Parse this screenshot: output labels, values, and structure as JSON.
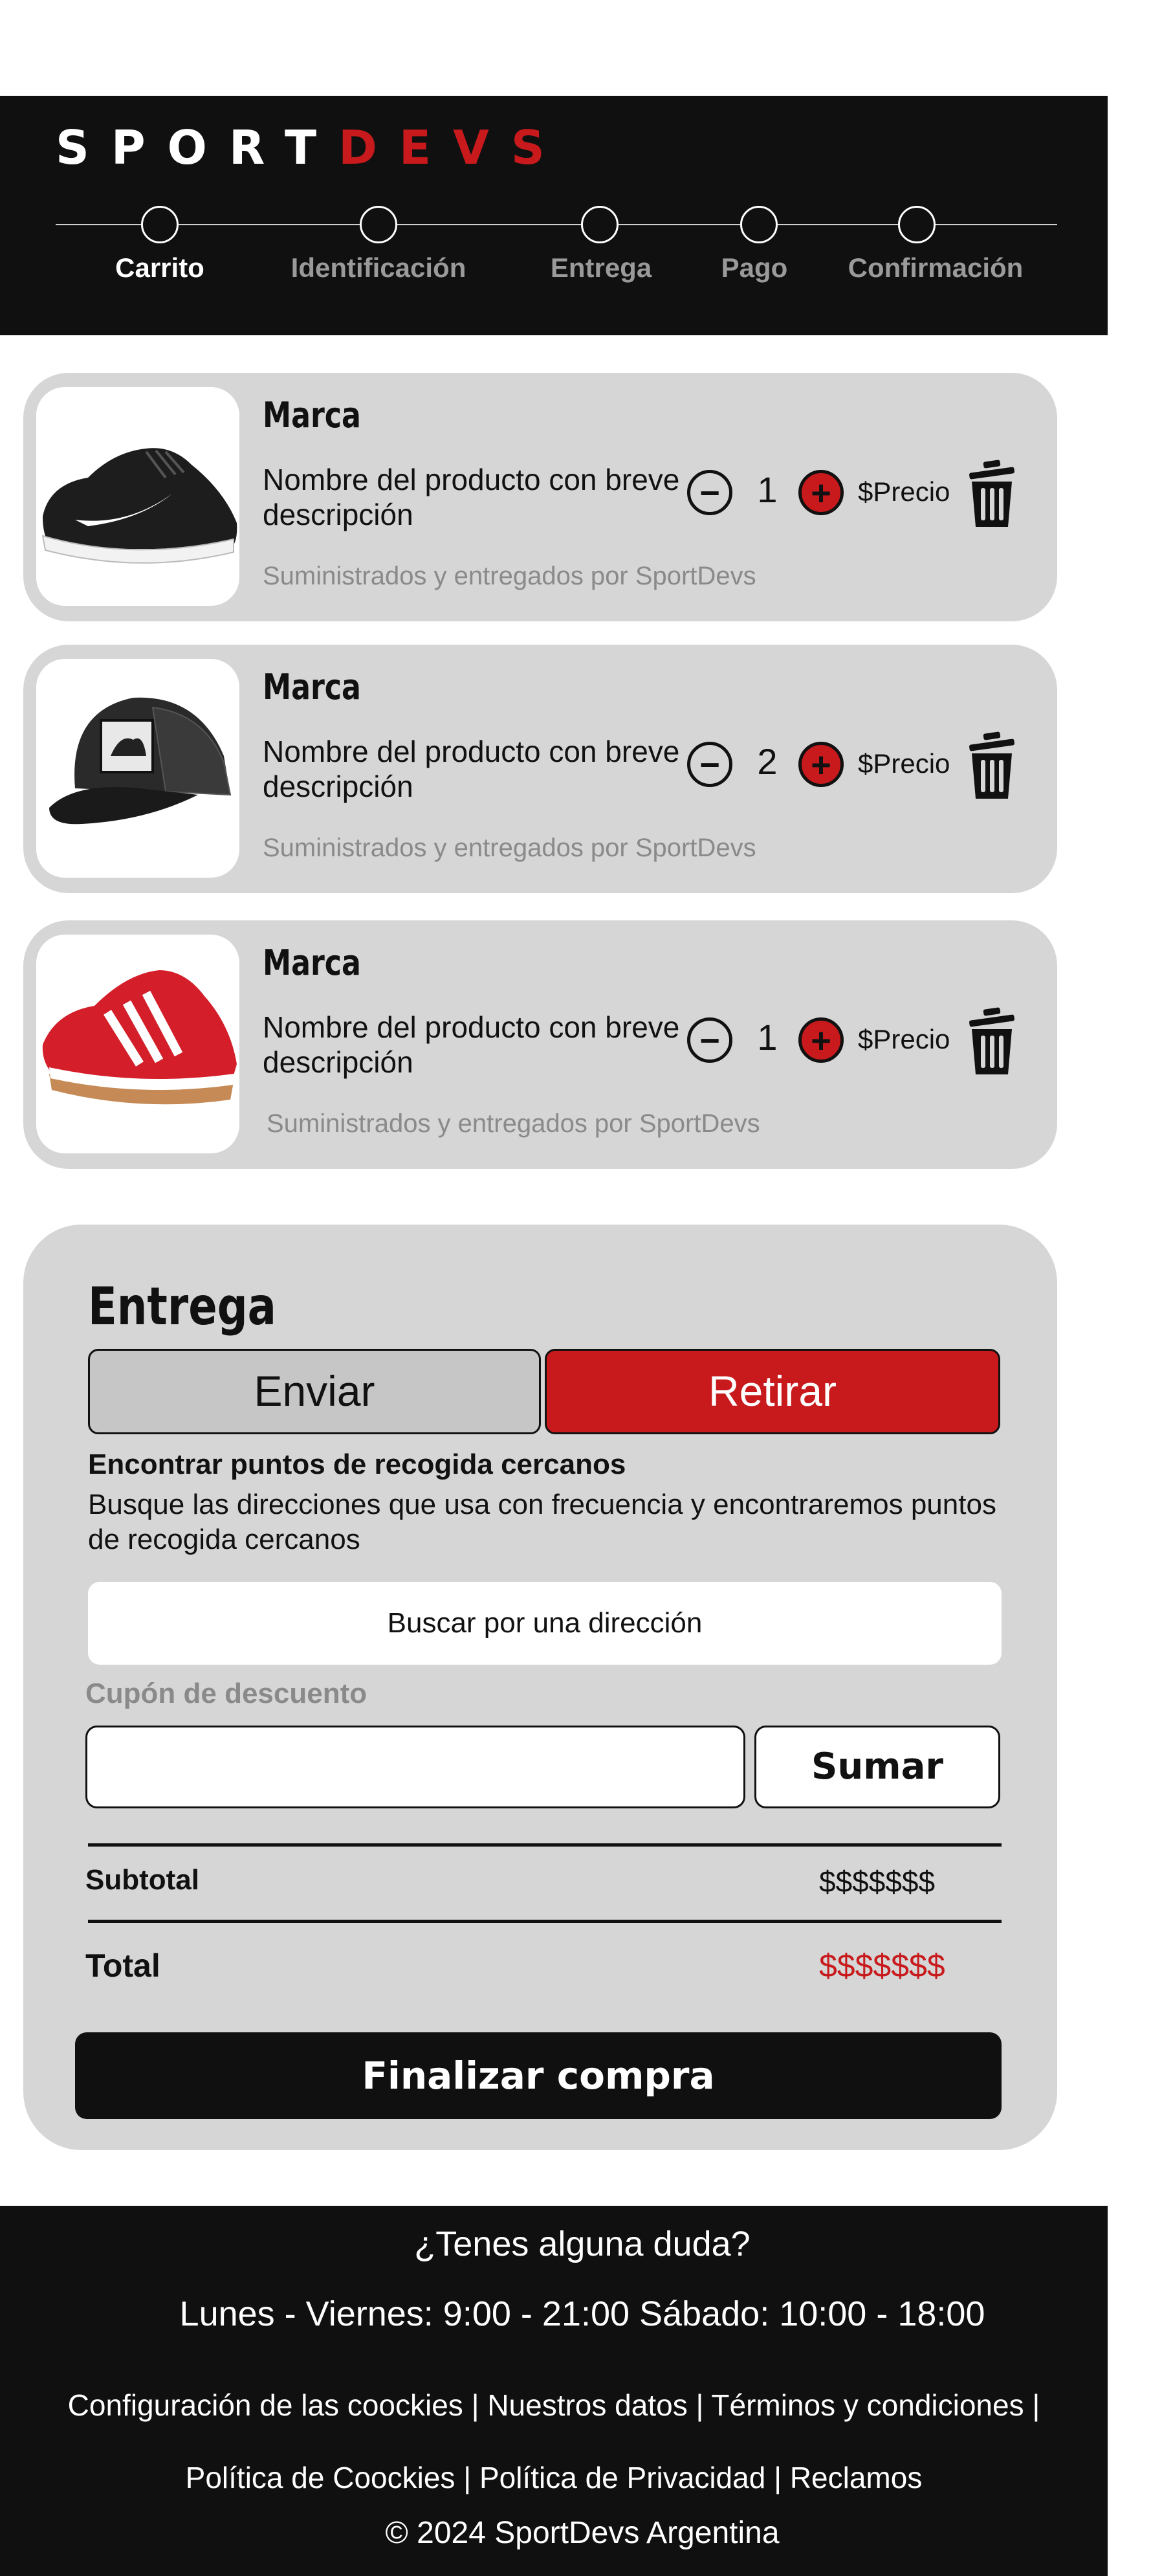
{
  "header": {
    "logo_part1": "SPORT",
    "logo_part2": "DEVS",
    "steps": [
      {
        "label": "Carrito",
        "active": true
      },
      {
        "label": "Identificación",
        "active": false
      },
      {
        "label": "Entrega",
        "active": false
      },
      {
        "label": "Pago",
        "active": false
      },
      {
        "label": "Confirmación",
        "active": false
      }
    ]
  },
  "cart": {
    "items": [
      {
        "brand": "Marca",
        "description": "Nombre del producto con breve descripción",
        "quantity": "1",
        "price": "$Precio",
        "supplier": "Suministrados y entregados por SportDevs",
        "image": "black-sneaker"
      },
      {
        "brand": "Marca",
        "description": "Nombre del producto con breve descripción",
        "quantity": "2",
        "price": "$Precio",
        "supplier": "Suministrados y entregados por SportDevs",
        "image": "black-trucker-cap"
      },
      {
        "brand": "Marca",
        "description": "Nombre del producto con breve descripción",
        "quantity": "1",
        "price": "$Precio",
        "supplier": "Suministrados y entregados por SportDevs",
        "image": "red-sneaker"
      }
    ],
    "minus_symbol": "−",
    "plus_symbol": "+"
  },
  "delivery": {
    "title": "Entrega",
    "option_send": "Enviar",
    "option_pickup": "Retirar",
    "find_title": "Encontrar puntos de recogida cercanos",
    "find_description": "Busque las direcciones que usa con frecuencia y encontraremos puntos de recogida cercanos",
    "search_button": "Buscar por una dirección",
    "coupon_label": "Cupón de descuento",
    "coupon_value": "",
    "coupon_button": "Sumar",
    "subtotal_label": "Subtotal",
    "subtotal_value": "$$$$$$$",
    "total_label": "Total",
    "total_value": "$$$$$$$",
    "checkout_button": "Finalizar compra"
  },
  "footer": {
    "question": "¿Tenes alguna duda?",
    "hours": "Lunes - Viernes: 9:00 - 21:00 Sábado: 10:00 - 18:00",
    "links": [
      "Configuración de las coockies",
      "Nuestros datos",
      "Términos y condiciones",
      "Política de Coockies",
      "Política de Privacidad",
      "Reclamos"
    ],
    "separator": " | ",
    "copyright": "©  2024  SportDevs Argentina"
  },
  "colors": {
    "brand_red": "#c81a1d",
    "dark": "#101010",
    "panel_gray": "#d6d6d6"
  }
}
